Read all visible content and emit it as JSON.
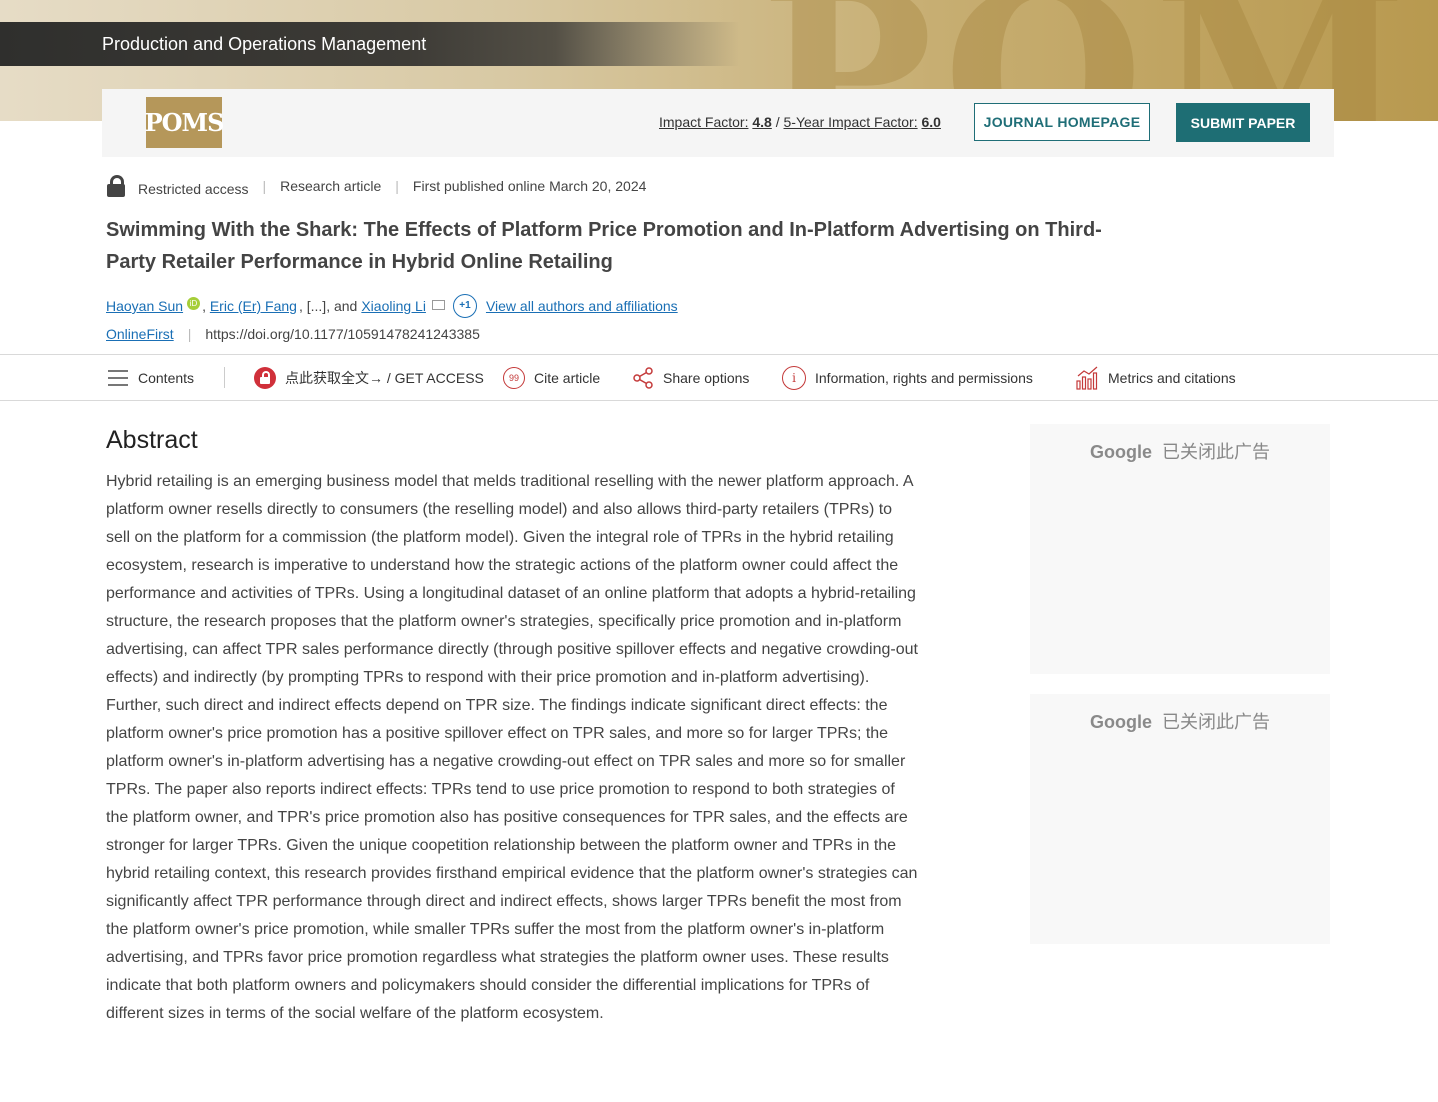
{
  "banner": {
    "decoration": "POM"
  },
  "journal": {
    "title": "Production and Operations Management",
    "logo_text": "POMS"
  },
  "header": {
    "impact_label": "Impact Factor:",
    "impact_value": "4.8",
    "separator": "/",
    "five_year_label": "5-Year Impact Factor:",
    "five_year_value": "6.0",
    "journal_homepage": "JOURNAL HOMEPAGE",
    "submit_paper": "SUBMIT PAPER"
  },
  "meta": {
    "access": "Restricted access",
    "type": "Research article",
    "published": "First published online March 20, 2024"
  },
  "article": {
    "title": "Swimming With the Shark: The Effects of Platform Price Promotion and In-Platform Advertising on Third-Party Retailer Performance in Hybrid Online Retailing",
    "authors": {
      "first": "Haoyan Sun",
      "orcid_icon": "iD",
      "second": "Eric (Er) Fang",
      "ellipsis": ", [...], and",
      "last": "Xiaoling Li",
      "plus_count": "+1",
      "view_all": "View all authors and affiliations"
    },
    "onlinefirst": "OnlineFirst",
    "doi": "https://doi.org/10.1177/10591478241243385"
  },
  "toolbar": {
    "contents": "Contents",
    "get_access": "点此获取全文→ / GET ACCESS",
    "cite": "Cite article",
    "cite_icon_text": "99",
    "share": "Share options",
    "info": "Information, rights and permissions",
    "info_icon_text": "i",
    "metrics": "Metrics and citations"
  },
  "abstract": {
    "heading": "Abstract",
    "text": "Hybrid retailing is an emerging business model that melds traditional reselling with the newer platform approach. A platform owner resells directly to consumers (the reselling model) and also allows third-party retailers (TPRs) to sell on the platform for a commission (the platform model). Given the integral role of TPRs in the hybrid retailing ecosystem, research is imperative to understand how the strategic actions of the platform owner could affect the performance and activities of TPRs. Using a longitudinal dataset of an online platform that adopts a hybrid-retailing structure, the research proposes that the platform owner's strategies, specifically price promotion and in-platform advertising, can affect TPR sales performance directly (through positive spillover effects and negative crowding-out effects) and indirectly (by prompting TPRs to respond with their price promotion and in-platform advertising). Further, such direct and indirect effects depend on TPR size. The findings indicate significant direct effects: the platform owner's price promotion has a positive spillover effect on TPR sales, and more so for larger TPRs; the platform owner's in-platform advertising has a negative crowding-out effect on TPR sales and more so for smaller TPRs. The paper also reports indirect effects: TPRs tend to use price promotion to respond to both strategies of the platform owner, and TPR's price promotion also has positive consequences for TPR sales, and the effects are stronger for larger TPRs. Given the unique coopetition relationship between the platform owner and TPRs in the hybrid retailing context, this research provides firsthand empirical evidence that the platform owner's strategies can significantly affect TPR performance through direct and indirect effects, shows larger TPRs benefit the most from the platform owner's price promotion, while smaller TPRs suffer the most from the platform owner's in-platform advertising, and TPRs favor price promotion regardless what strategies the platform owner uses. These results indicate that both platform owners and policymakers should consider the differential implications for TPRs of different sizes in terms of the social welfare of the platform ecosystem."
  },
  "ads": [
    {
      "brand": "Google",
      "status": "已关闭此广告"
    },
    {
      "brand": "Google",
      "status": "已关闭此广告"
    }
  ]
}
